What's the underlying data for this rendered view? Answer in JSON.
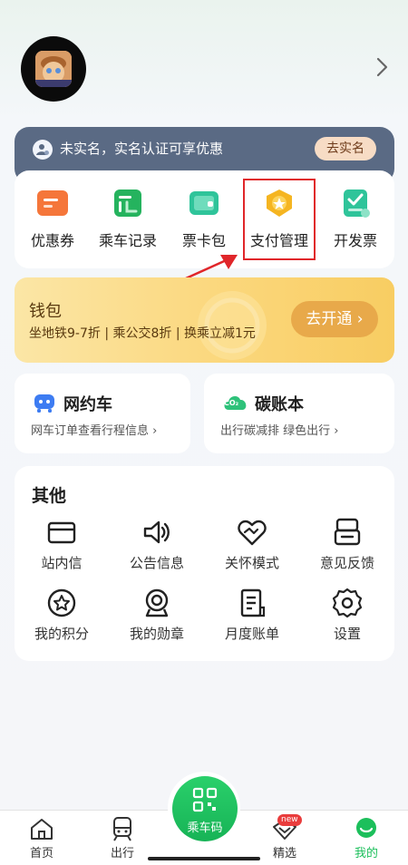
{
  "profile": {
    "arrow": "chevron-right-icon"
  },
  "realname": {
    "text": "未实名，实名认证可享优惠",
    "button": "去实名"
  },
  "quick": [
    {
      "label": "优惠券",
      "icon": "coupon-icon",
      "color": "#f5763a"
    },
    {
      "label": "乘车记录",
      "icon": "ride-record-icon",
      "color": "#25b35e"
    },
    {
      "label": "票卡包",
      "icon": "card-wallet-icon",
      "color": "#2fc49a"
    },
    {
      "label": "支付管理",
      "icon": "payment-manage-icon",
      "color": "#f5b521"
    },
    {
      "label": "开发票",
      "icon": "invoice-icon",
      "color": "#2fc49a"
    }
  ],
  "wallet": {
    "title": "钱包",
    "desc": "坐地铁9-7折 | 乘公交8折 | 换乘立减1元",
    "button": "去开通 ›"
  },
  "ride_hailing": {
    "title": "网约车",
    "desc": "网车订单查看行程信息 ›"
  },
  "carbon": {
    "title": "碳账本",
    "desc": "出行碳减排 绿色出行 ›",
    "badge": "CO₂"
  },
  "others": {
    "title": "其他",
    "items": [
      {
        "label": "站内信",
        "icon": "mail-icon"
      },
      {
        "label": "公告信息",
        "icon": "announcement-icon"
      },
      {
        "label": "关怀模式",
        "icon": "care-mode-icon"
      },
      {
        "label": "意见反馈",
        "icon": "feedback-icon"
      },
      {
        "label": "我的积分",
        "icon": "points-icon"
      },
      {
        "label": "我的勋章",
        "icon": "medal-icon"
      },
      {
        "label": "月度账单",
        "icon": "bill-icon"
      },
      {
        "label": "设置",
        "icon": "settings-icon"
      }
    ]
  },
  "nav": {
    "home": "首页",
    "travel": "出行",
    "ride_code": "乘车码",
    "featured": "精选",
    "featured_badge": "new",
    "mine": "我的"
  },
  "colors": {
    "accent": "#1cbf5b",
    "highlight": "#e0262a",
    "banner": "#5a6a84"
  }
}
